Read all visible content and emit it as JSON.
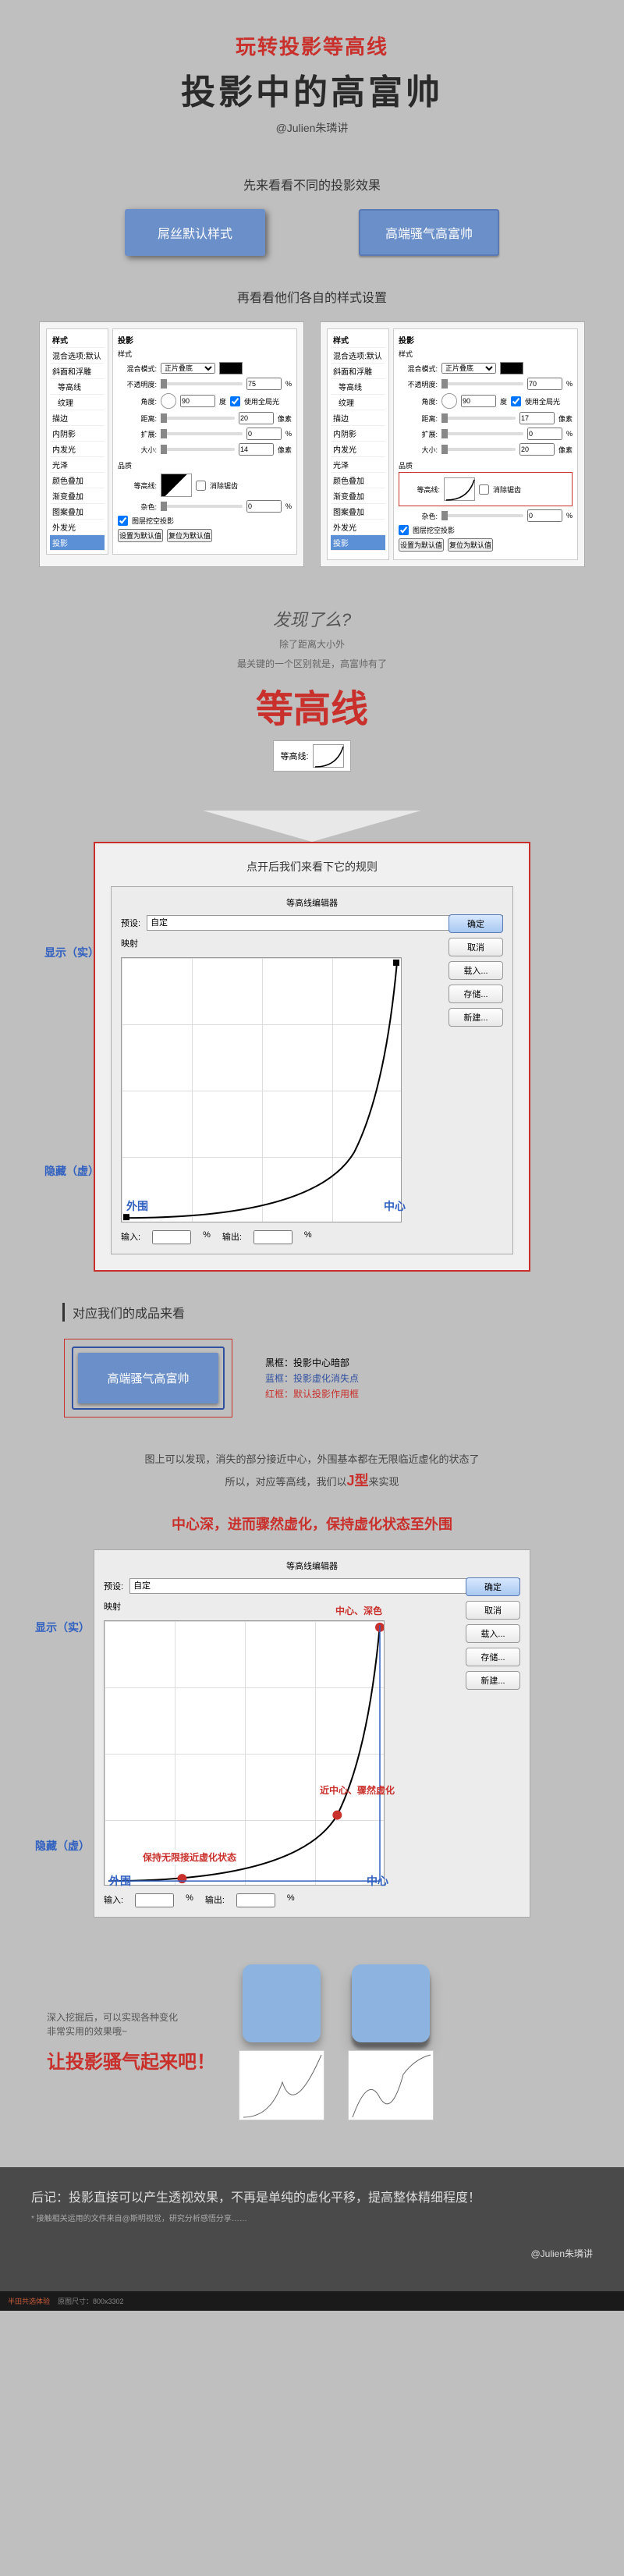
{
  "header": {
    "subtitle": "玩转投影等高线",
    "title": "投影中的高富帅",
    "author": "@Julien朱璘讲"
  },
  "section1": {
    "title": "先来看看不同的投影效果",
    "ex_default": "屌丝默认样式",
    "ex_fancy": "高端骚气高富帅"
  },
  "section2": {
    "title": "再看看他们各自的样式设置"
  },
  "panel": {
    "header_style": "样式",
    "header_shadow": "投影",
    "items": [
      "混合选项:默认",
      "斜面和浮雕",
      "等高线",
      "纹理",
      "描边",
      "内阴影",
      "内发光",
      "光泽",
      "颜色叠加",
      "渐变叠加",
      "图案叠加",
      "外发光",
      "投影"
    ],
    "active_item": "投影",
    "labels": {
      "blend": "混合模式:",
      "opacity": "不透明度:",
      "angle": "角度:",
      "global": "使用全局光",
      "distance": "距离:",
      "spread": "扩展:",
      "size": "大小:",
      "quality": "品质",
      "contour": "等高线:",
      "antialias": "消除锯齿",
      "noise": "杂色:",
      "knockout": "图层挖空投影",
      "default_btn": "设置为默认值",
      "reset_btn": "复位为默认值"
    },
    "left": {
      "blend_val": "正片叠底",
      "opacity_val": "75",
      "angle_val": "90",
      "distance_val": "20",
      "spread_val": "0",
      "size_val": "14",
      "noise_val": "0"
    },
    "right": {
      "blend_val": "正片叠底",
      "opacity_val": "70",
      "angle_val": "90",
      "distance_val": "17",
      "spread_val": "0",
      "size_val": "20",
      "noise_val": "0"
    },
    "units": {
      "pct": "%",
      "deg": "度",
      "px": "像素"
    }
  },
  "discover": {
    "q": "发现了么?",
    "sub1": "除了距离大小外",
    "sub2": "最关键的一个区别就是，高富帅有了",
    "big": "等高线",
    "contour_label": "等高线:"
  },
  "editor1": {
    "box_title": "点开后我们来看下它的规则",
    "panel_title": "等高线编辑器",
    "preset": "预设:",
    "preset_val": "自定",
    "mapping": "映射",
    "btns": {
      "ok": "确定",
      "cancel": "取消",
      "load": "载入...",
      "save": "存储...",
      "new": "新建..."
    },
    "input_lbl": "输入:",
    "output_lbl": "输出:",
    "pct": "%",
    "anno": {
      "show": "显示（实）",
      "hide": "隐藏（虚）",
      "outer": "外围",
      "center": "中心"
    }
  },
  "result": {
    "title": "对应我们的成品来看",
    "box_label": "高端骚气高富帅",
    "legend": {
      "black": "黑框：投影中心暗部",
      "blue": "蓝框：投影虚化消失点",
      "red": "红框：默认投影作用框"
    }
  },
  "explain": {
    "line1": "图上可以发现，消失的部分接近中心，外围基本都在无限临近虚化的状态了",
    "line2a": "所以，对应等高线，我们以",
    "jtype": "J型",
    "line2b": "来实现"
  },
  "principle": "中心深，进而骤然虚化，保持虚化状态至外围",
  "editor2": {
    "panel_title": "等高线编辑器",
    "preset": "预设:",
    "preset_val": "自定",
    "mapping": "映射",
    "btns": {
      "ok": "确定",
      "cancel": "取消",
      "load": "载入...",
      "save": "存储...",
      "new": "新建..."
    },
    "input_lbl": "输入:",
    "output_lbl": "输出:",
    "pct": "%",
    "anno": {
      "show": "显示（实）",
      "hide": "隐藏（虚）",
      "outer": "外围",
      "center": "中心",
      "a1": "中心、深色",
      "a2": "近中心、骤然虚化",
      "a3": "保持无限接近虚化状态"
    }
  },
  "final": {
    "sub1": "深入挖掘后，可以实现各种变化",
    "sub2": "非常实用的效果哦~",
    "title": "让投影骚气起来吧！"
  },
  "footer": {
    "main": "后记：投影直接可以产生透视效果，不再是单纯的虚化平移，提高整体精细程度！",
    "sub": "* 接触相关运用的文件来自@斯明视觉，研究分析感悟分享……",
    "author": "@Julien朱璘讲",
    "bar1": "半田共选体验",
    "bar2": "原图尺寸：800x3302"
  }
}
